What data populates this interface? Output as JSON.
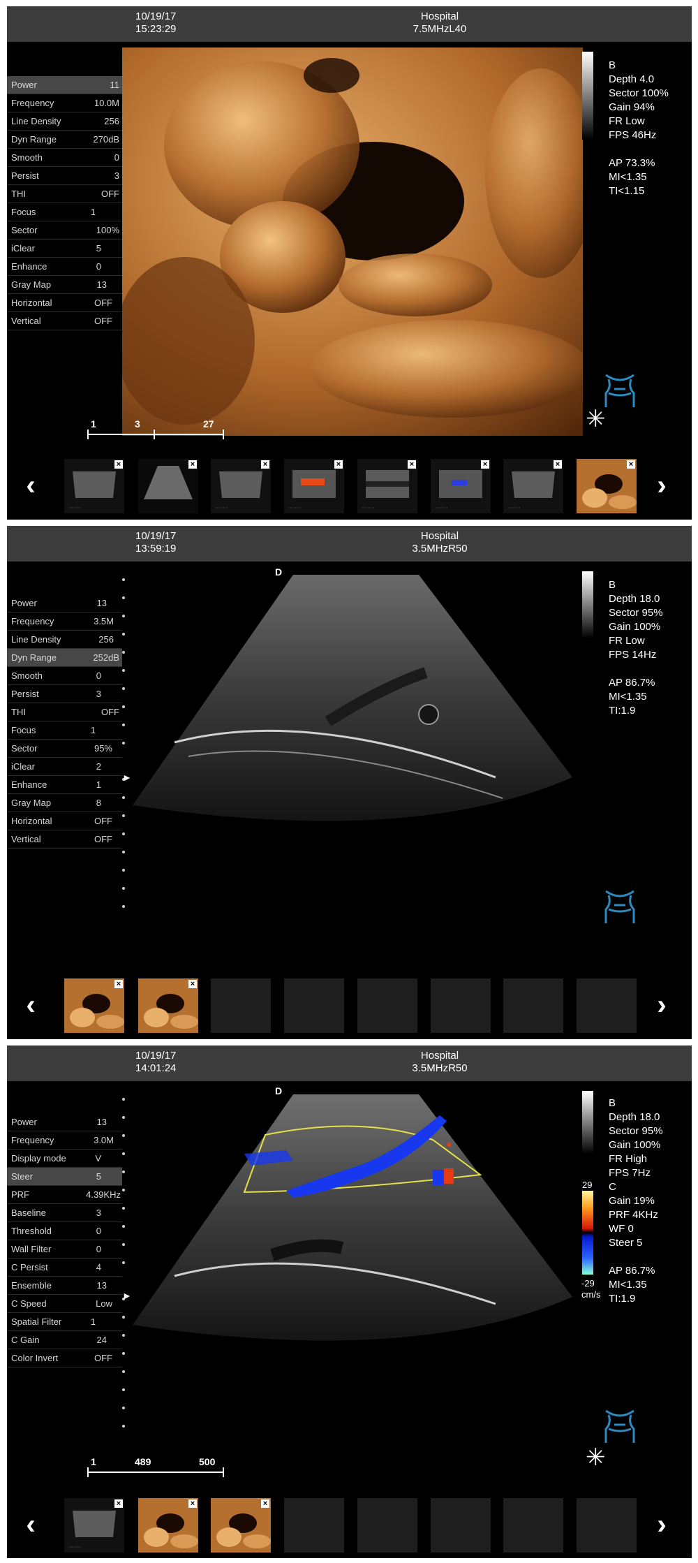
{
  "panels": [
    {
      "header": {
        "date": "10/19/17",
        "time": "15:23:29",
        "site": "Hospital",
        "probe": "7.5MHzL40"
      },
      "params": [
        {
          "label": "Power",
          "value": "11",
          "selected": true
        },
        {
          "label": "Frequency",
          "value": "10.0M"
        },
        {
          "label": "Line Density",
          "value": "256"
        },
        {
          "label": "Dyn Range",
          "value": "270dB"
        },
        {
          "label": "Smooth",
          "value": "0"
        },
        {
          "label": "Persist",
          "value": "3"
        },
        {
          "label": "THI",
          "value": "OFF"
        },
        {
          "label": "Focus",
          "value": "1"
        },
        {
          "label": "Sector",
          "value": "100%"
        },
        {
          "label": "iClear",
          "value": "5"
        },
        {
          "label": "Enhance",
          "value": "0"
        },
        {
          "label": "Gray Map",
          "value": "13"
        },
        {
          "label": "Horizontal",
          "value": "OFF"
        },
        {
          "label": "Vertical",
          "value": "OFF"
        }
      ],
      "info": [
        "B",
        "Depth 4.0",
        "Sector 100%",
        "Gain 94%",
        "FR Low",
        "FPS 46Hz",
        "",
        "AP 73.3%",
        "MI<1.35",
        "TI<1.15"
      ],
      "ruler": {
        "a": "1",
        "b": "3",
        "c": "27"
      },
      "thumbnails": [
        "b-mode",
        "b-mode",
        "b-mode",
        "color",
        "b-mode",
        "color",
        "b-mode",
        "3d"
      ]
    },
    {
      "header": {
        "date": "10/19/17",
        "time": "13:59:19",
        "site": "Hospital",
        "probe": "3.5MHzR50"
      },
      "params": [
        {
          "label": "Power",
          "value": "13"
        },
        {
          "label": "Frequency",
          "value": "3.5M"
        },
        {
          "label": "Line Density",
          "value": "256"
        },
        {
          "label": "Dyn Range",
          "value": "252dB",
          "selected": true
        },
        {
          "label": "Smooth",
          "value": "0"
        },
        {
          "label": "Persist",
          "value": "3"
        },
        {
          "label": "THI",
          "value": "OFF"
        },
        {
          "label": "Focus",
          "value": "1"
        },
        {
          "label": "Sector",
          "value": "95%"
        },
        {
          "label": "iClear",
          "value": "2"
        },
        {
          "label": "Enhance",
          "value": "1"
        },
        {
          "label": "Gray Map",
          "value": "8"
        },
        {
          "label": "Horizontal",
          "value": "OFF"
        },
        {
          "label": "Vertical",
          "value": "OFF"
        }
      ],
      "mark": "D",
      "info": [
        "B",
        "Depth 18.0",
        "Sector 95%",
        "Gain 100%",
        "FR Low",
        "FPS 14Hz",
        "",
        "AP 86.7%",
        "MI<1.35",
        "TI:1.9"
      ],
      "thumbnails": [
        "3d",
        "3d",
        "empty",
        "empty",
        "empty",
        "empty",
        "empty",
        "empty"
      ]
    },
    {
      "header": {
        "date": "10/19/17",
        "time": "14:01:24",
        "site": "Hospital",
        "probe": "3.5MHzR50"
      },
      "params": [
        {
          "label": "Power",
          "value": "13"
        },
        {
          "label": "Frequency",
          "value": "3.0M"
        },
        {
          "label": "Display mode",
          "value": "V"
        },
        {
          "label": "Steer",
          "value": "5",
          "selected": true
        },
        {
          "label": "PRF",
          "value": "4.39KHz"
        },
        {
          "label": "Baseline",
          "value": "3"
        },
        {
          "label": "Threshold",
          "value": "0"
        },
        {
          "label": "Wall Filter",
          "value": "0"
        },
        {
          "label": "C Persist",
          "value": "4"
        },
        {
          "label": "Ensemble",
          "value": "13"
        },
        {
          "label": "C Speed",
          "value": "Low"
        },
        {
          "label": "Spatial Filter",
          "value": "1"
        },
        {
          "label": "C Gain",
          "value": "24"
        },
        {
          "label": "Color Invert",
          "value": "OFF"
        }
      ],
      "mark": "D",
      "info_b": [
        "B",
        "Depth 18.0",
        "Sector 95%",
        "Gain 100%",
        "FR High",
        "FPS 7Hz"
      ],
      "info_c": [
        "C",
        "Gain  19%",
        "PRF 4KHz",
        "WF 0",
        "Steer 5",
        "",
        "AP 86.7%",
        "MI<1.35",
        "TI:1.9"
      ],
      "colormap": {
        "top": "29",
        "bottom": "-29",
        "unit": "cm/s"
      },
      "ruler": {
        "a": "1",
        "b": "489",
        "c": "500"
      },
      "thumbnails": [
        "b-mode",
        "3d",
        "3d",
        "empty",
        "empty",
        "empty",
        "empty",
        "empty"
      ]
    }
  ],
  "thumb_label": "········",
  "close_glyph": "×",
  "prev_glyph": "‹",
  "next_glyph": "›",
  "snow_glyph": "✳",
  "colors": {
    "header": "#3d3d3d",
    "selected_row": "#474747",
    "roi": "#e6e04a",
    "probe_icon": "#2d8bc0"
  }
}
